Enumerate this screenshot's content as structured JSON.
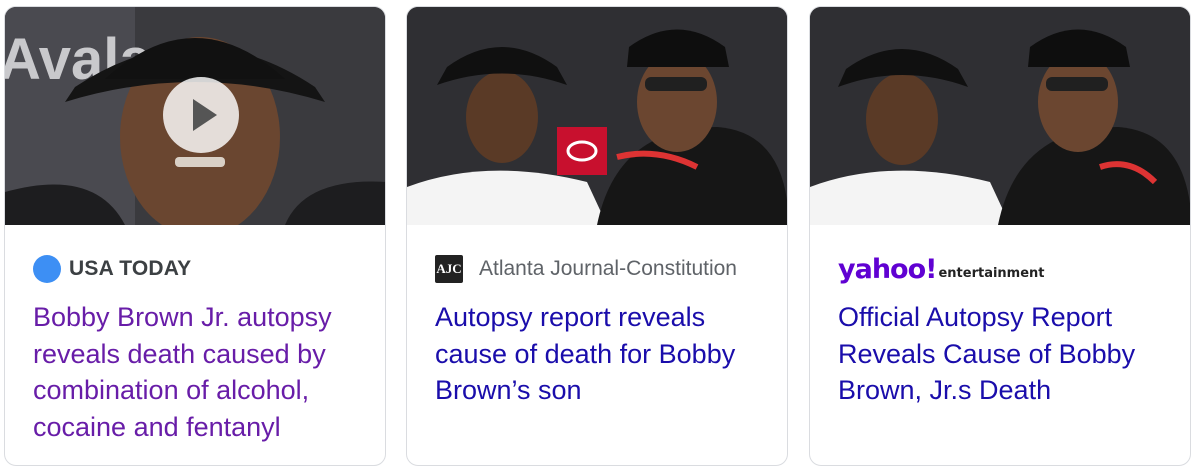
{
  "cards": [
    {
      "source": "USA TODAY",
      "source_icon": "usa-today-dot-icon",
      "headline": "Bobby Brown Jr. autopsy reveals death caused by combination of alcohol, cocaine and fentanyl",
      "visited": true,
      "has_video": true,
      "thumbnail_text": "Avala"
    },
    {
      "source": "Atlanta Journal-Constitution",
      "source_icon": "ajc-logo-icon",
      "logo_text": "AJC",
      "headline": "Autopsy report reveals cause of death for Bobby Brown’s son",
      "visited": false
    },
    {
      "source_logo_word": "yahoo!",
      "source_logo_sub": "entertainment",
      "source_icon": "yahoo-entertainment-logo",
      "headline": "Official Autopsy Report Reveals Cause of Bobby Brown, Jr.s Death",
      "visited": false
    }
  ],
  "colors": {
    "link": "#1a0dab",
    "visited": "#681da8",
    "yahoo": "#6001d2",
    "usa_dot": "#3d8ff4"
  }
}
